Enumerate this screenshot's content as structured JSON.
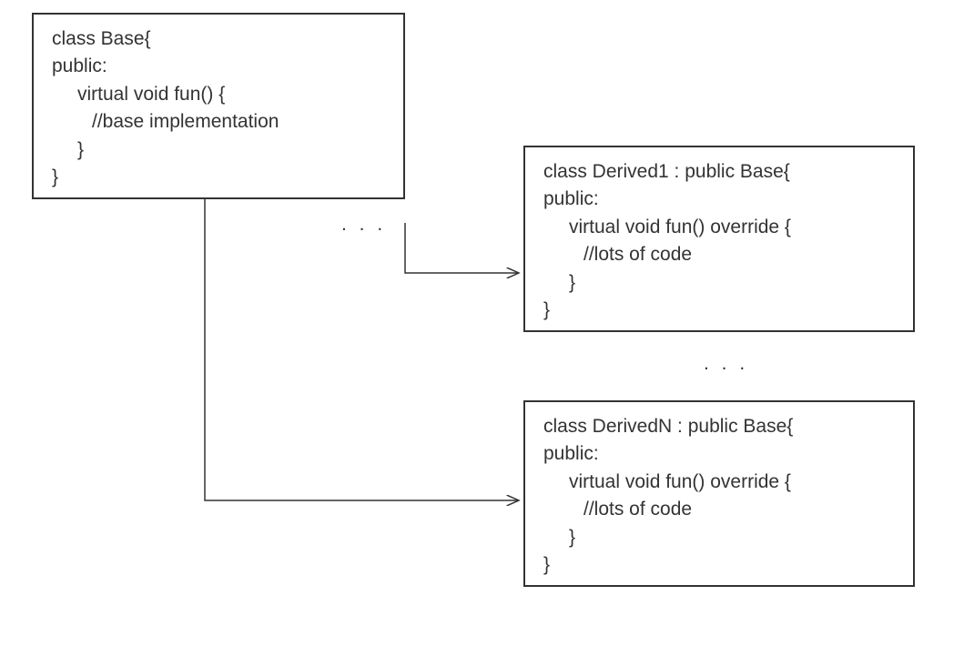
{
  "base": {
    "l1": "class Base{",
    "l2": "public:",
    "l3": "virtual void fun() {",
    "l4": "//base implementation",
    "l5": "}",
    "l6": "}"
  },
  "derived1": {
    "l1": "class Derived1 : public Base{",
    "l2": "public:",
    "l3": "virtual void fun() override {",
    "l4": "//lots of code",
    "l5": "}",
    "l6": "}"
  },
  "derivedN": {
    "l1": "class DerivedN : public Base{",
    "l2": "public:",
    "l3": "virtual void fun() override {",
    "l4": "//lots of code",
    "l5": "}",
    "l6": "}"
  },
  "ellipsis1": ". . .",
  "ellipsis2": ". . ."
}
